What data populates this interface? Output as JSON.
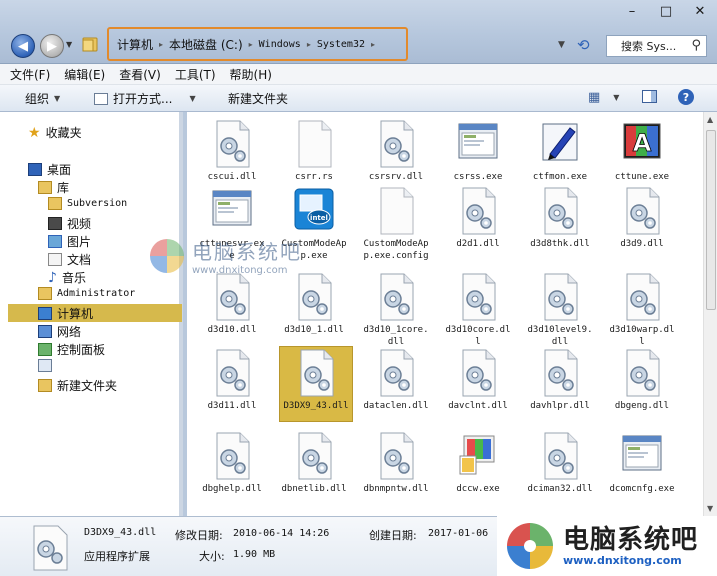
{
  "window": {
    "minimize": "–",
    "maximize": "□",
    "close": "✕"
  },
  "address": {
    "segments": [
      "计算机",
      "本地磁盘 (C:)",
      "Windows",
      "System32"
    ]
  },
  "search": {
    "placeholder": "搜索 Sys..."
  },
  "menu": [
    "文件(F)",
    "编辑(E)",
    "查看(V)",
    "工具(T)",
    "帮助(H)"
  ],
  "toolbar": {
    "organize": "组织",
    "open_with": "打开方式...",
    "new_folder": "新建文件夹"
  },
  "sidebar": {
    "favorites": "收藏夹",
    "desktop": "桌面",
    "libraries": "库",
    "subversion": "Subversion",
    "videos": "视频",
    "pictures": "图片",
    "documents": "文档",
    "music": "音乐",
    "administrator": "Administrator",
    "computer": "计算机",
    "network": "网络",
    "control_panel": "控制面板",
    "new_folder": "新建文件夹"
  },
  "files": [
    {
      "name": "cscui.dll",
      "type": "dll"
    },
    {
      "name": "csrr.rs",
      "type": "blank"
    },
    {
      "name": "csrsrv.dll",
      "type": "dll"
    },
    {
      "name": "csrss.exe",
      "type": "win"
    },
    {
      "name": "ctfmon.exe",
      "type": "pen"
    },
    {
      "name": "cttune.exe",
      "type": "atext"
    },
    {
      "name": "cttunesvr.exe",
      "type": "win"
    },
    {
      "name": "CustomModeApp.exe",
      "type": "intel"
    },
    {
      "name": "CustomModeApp.exe.config",
      "type": "blank"
    },
    {
      "name": "d2d1.dll",
      "type": "dll"
    },
    {
      "name": "d3d8thk.dll",
      "type": "dll"
    },
    {
      "name": "d3d9.dll",
      "type": "dll"
    },
    {
      "name": "d3d10.dll",
      "type": "dll"
    },
    {
      "name": "d3d10_1.dll",
      "type": "dll"
    },
    {
      "name": "d3d10_1core.dll",
      "type": "dll"
    },
    {
      "name": "d3d10core.dll",
      "type": "dll"
    },
    {
      "name": "d3d10level9.dll",
      "type": "dll"
    },
    {
      "name": "d3d10warp.dll",
      "type": "dll"
    },
    {
      "name": "d3d11.dll",
      "type": "dll"
    },
    {
      "name": "D3DX9_43.dll",
      "type": "dll",
      "selected": true
    },
    {
      "name": "dataclen.dll",
      "type": "dll"
    },
    {
      "name": "davclnt.dll",
      "type": "dll"
    },
    {
      "name": "davhlpr.dll",
      "type": "dll"
    },
    {
      "name": "dbgeng.dll",
      "type": "dll"
    },
    {
      "name": "dbghelp.dll",
      "type": "dll"
    },
    {
      "name": "dbnetlib.dll",
      "type": "dll"
    },
    {
      "name": "dbnmpntw.dll",
      "type": "dll"
    },
    {
      "name": "dccw.exe",
      "type": "color"
    },
    {
      "name": "dciman32.dll",
      "type": "dll"
    },
    {
      "name": "dcomcnfg.exe",
      "type": "win"
    }
  ],
  "details": {
    "filename": "D3DX9_43.dll",
    "modified_label": "修改日期:",
    "modified_value": "2010-06-14 14:26",
    "created_label": "创建日期:",
    "created_value": "2017-01-06",
    "type": "应用程序扩展",
    "size_label": "大小:",
    "size_value": "1.90 MB"
  },
  "watermark": {
    "title": "电脑系统吧",
    "url": "www.dnxitong.com"
  },
  "brand": {
    "title": "电脑系统吧",
    "url": "www.dnxitong.com"
  },
  "colors": {
    "address_highlight": "#e28a2c",
    "selection": "#d9b945"
  }
}
